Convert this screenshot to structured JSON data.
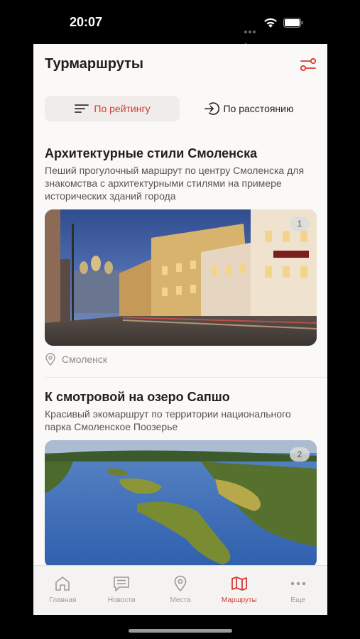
{
  "status": {
    "time": "20:07"
  },
  "header": {
    "title": "Турмаршруты"
  },
  "sort": {
    "rating_label": "По рейтингу",
    "distance_label": "По расстоянию",
    "active": "rating"
  },
  "routes": [
    {
      "title": "Архитектурные стили Смоленска",
      "description": "Пеший прогулочный маршрут по центру Смоленска для знакомства с архитектурными стилями на примере исторических зданий города",
      "rank": "1",
      "location": "Смоленск"
    },
    {
      "title": "К смотровой на озеро Сапшо",
      "description": "Красивый экомаршрут по территории национального парка Смоленское Поозерье",
      "rank": "2"
    }
  ],
  "tabs": [
    {
      "label": "Главная",
      "icon": "home-icon"
    },
    {
      "label": "Новости",
      "icon": "news-icon"
    },
    {
      "label": "Места",
      "icon": "map-pin-icon"
    },
    {
      "label": "Маршруты",
      "icon": "map-icon"
    },
    {
      "label": "Еще",
      "icon": "more-icon"
    }
  ],
  "colors": {
    "accent": "#d33a35",
    "background": "#fbf9f7"
  }
}
